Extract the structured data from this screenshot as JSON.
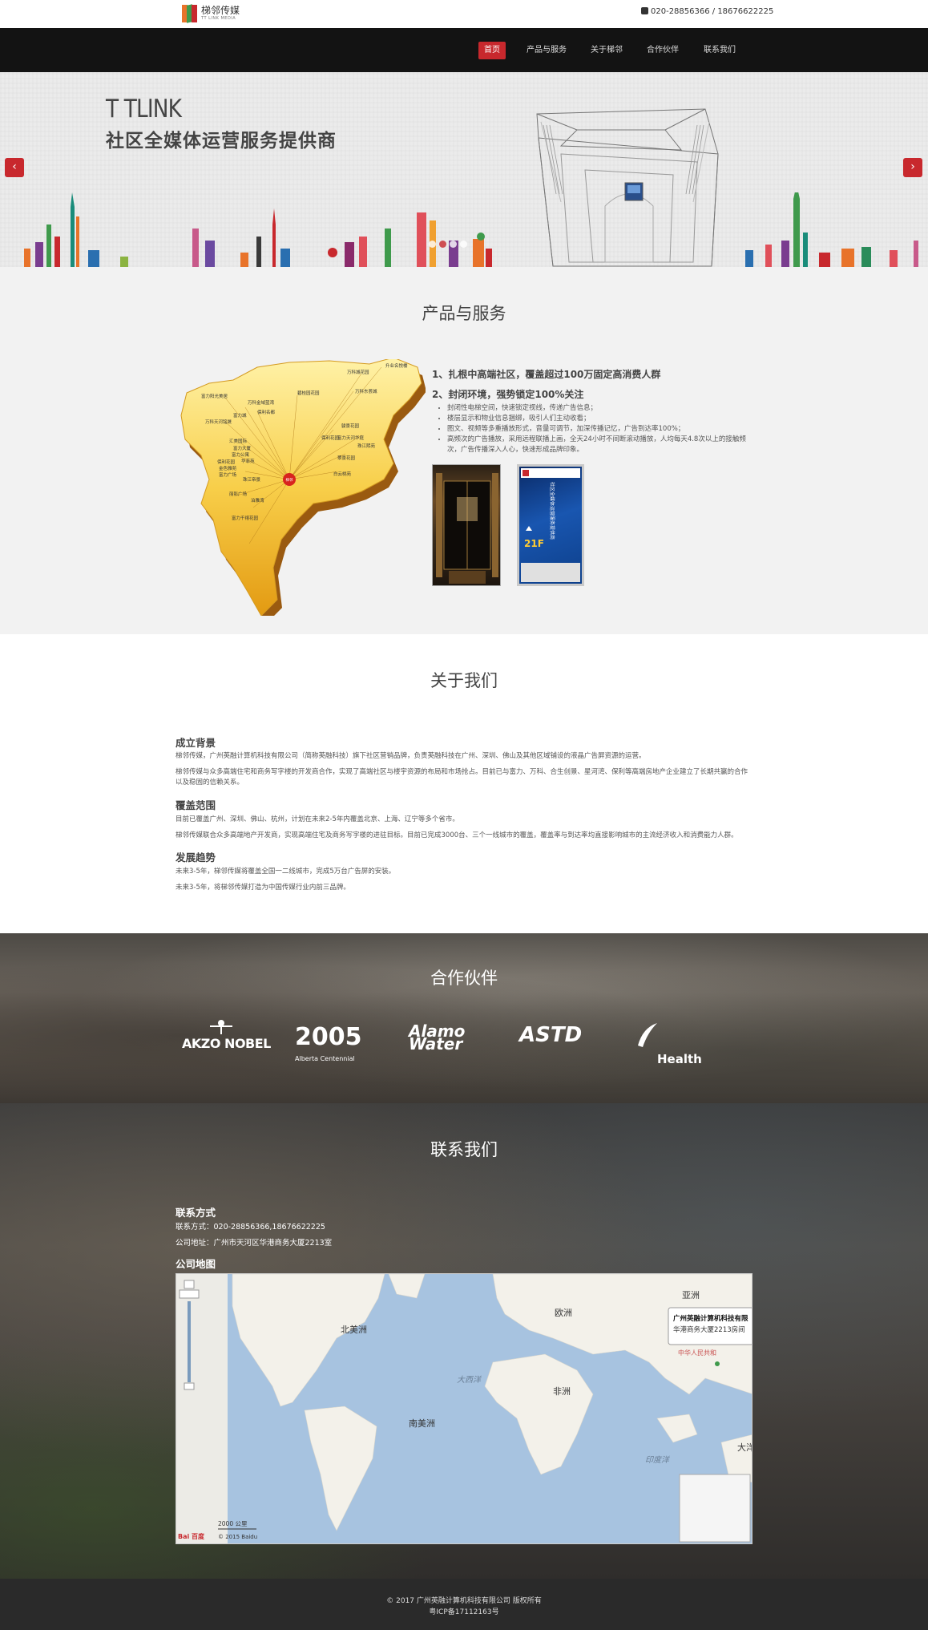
{
  "topbar": {
    "logo_name": "梯邻传媒",
    "logo_sub": "TT LINK MEDIA",
    "phone": "020-28856366 / 18676622225"
  },
  "nav": {
    "items": [
      {
        "label": "首页",
        "active": true
      },
      {
        "label": "产品与服务",
        "active": false
      },
      {
        "label": "关于梯邻",
        "active": false
      },
      {
        "label": "合作伙伴",
        "active": false
      },
      {
        "label": "联系我们",
        "active": false
      }
    ]
  },
  "hero": {
    "title": "T TLINK",
    "subtitle": "社区全媒体运营服务提供商",
    "prev_icon": "chevron-left-icon",
    "next_icon": "chevron-right-icon",
    "prev_glyph": "‹",
    "next_glyph": "›"
  },
  "products": {
    "title": "产品与服务",
    "heading1": "1、扎根中高端社区，覆盖超过100万固定高消费人群",
    "heading2": "2、封闭环境，强势锁定100%关注",
    "bullets": [
      "封闭性电梯空间，快速锁定视线，传递广告信息；",
      "楼层显示和物业信息捆绑，吸引人们主动收看；",
      "图文、视频等多重播放形式，音量可调节，加深传播记忆，广告到达率100%；",
      "高频次的广告播放，采用远程联播上画，全天24小时不间断滚动播放，人均每天4.8次以上的接触频次，广告传播深入人心，快速形成品牌印象。"
    ],
    "map_labels": [
      "升业名悦楼",
      "万科城花园",
      "万科东荟城",
      "富力阳光美居",
      "万科金域蓝湾",
      "碧桂园花园",
      "保利名都",
      "富力城",
      "万科天河铭晟",
      "汇美国际",
      "富力天河华庭",
      "富力大厦",
      "珠江熙苑",
      "富力公寓",
      "华菲苑",
      "保利花园",
      "翠景花园",
      "保利花园",
      "金色雅苑",
      "富力广场",
      "白云桃苑",
      "珠江帝景",
      "骏景花园",
      "丽影广场",
      "泊雅湾",
      "富力千禧花园"
    ],
    "map_center_label": "梯邻",
    "panel_text": "社区全媒体运营服务提供商",
    "panel_floor": "21F"
  },
  "about": {
    "title": "关于我们",
    "sections": [
      {
        "heading": "成立背景",
        "paragraphs": [
          "梯邻传媒，广州英融计算机科技有限公司（简称英融科技）旗下社区营销品牌，负责英融科技在广州、深圳、佛山及其他区域铺设的液晶广告屏资源的运营。",
          "梯邻传媒与众多高端住宅和商务写字楼的开发商合作，实现了高端社区与楼宇资源的布局和市场抢占。目前已与富力、万科、合生创景、星河湾、保利等高端房地产企业建立了长期共赢的合作以及稳固的信赖关系。"
        ]
      },
      {
        "heading": "覆盖范围",
        "paragraphs": [
          "目前已覆盖广州、深圳、佛山、杭州，计划在未来2-5年内覆盖北京、上海、辽宁等多个省市。",
          "梯邻传媒联合众多高端地产开发商，实现高端住宅及商务写字楼的进驻目标。目前已完成3000台、三个一线城市的覆盖，覆盖率与到达率均直接影响城市的主流经济收入和消费能力人群。"
        ]
      },
      {
        "heading": "发展趋势",
        "paragraphs": [
          "未来3-5年，梯邻传媒将覆盖全国一二线城市，完成5万台广告屏的安装。",
          "未来3-5年，将梯邻传媒打造为中国传媒行业内前三品牌。"
        ]
      }
    ]
  },
  "partners": {
    "title": "合作伙伴",
    "logos": [
      {
        "name": "AKZO NOBEL",
        "sub": ""
      },
      {
        "name": "2005",
        "sub": "Alberta Centennial"
      },
      {
        "name": "Alamo Water",
        "sub": ""
      },
      {
        "name": "ASTD",
        "sub": ""
      },
      {
        "name": "Health",
        "sub": ""
      }
    ]
  },
  "contact": {
    "title": "联系我们",
    "method_heading": "联系方式",
    "phone_line": "联系方式：020-28856366,18676622225",
    "address_line": "公司地址：广州市天河区华港商务大厦2213室",
    "map_heading": "公司地图",
    "map": {
      "continents": {
        "north_america": "北美洲",
        "europe": "欧洲",
        "asia": "亚洲",
        "africa": "非洲",
        "south_america": "南美洲",
        "atlantic": "大西洋",
        "indian": "印度洋",
        "oceania": "大洋"
      },
      "popup_title": "广州英融计算机科技有限",
      "popup_addr": "华港商务大厦2213房间",
      "country_label": "中华人民共和",
      "scale": "2000 公里",
      "copyright": "© 2015 Baidu",
      "brand": "Bai 百度"
    }
  },
  "footer": {
    "copyright": "© 2017 广州英融计算机科技有限公司 版权所有",
    "icp": "粤ICP备17112163号"
  },
  "colors": {
    "accent": "#c8282d",
    "nav_bg": "#131313",
    "footer_bg": "#2a2a2a",
    "section_gray": "#f2f2f2"
  }
}
